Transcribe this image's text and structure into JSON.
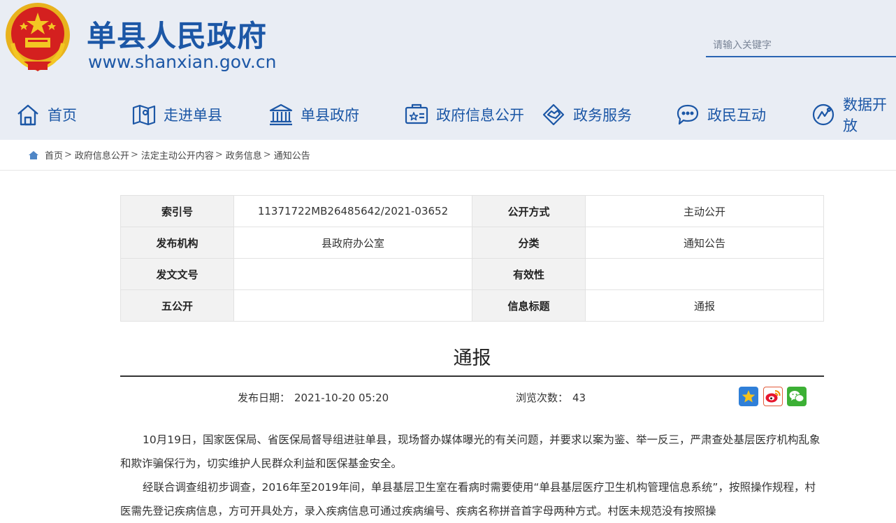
{
  "header": {
    "site_title": "单县人民政府",
    "site_url": "www.shanxian.gov.cn",
    "search_placeholder": "请输入关键字"
  },
  "nav": {
    "items": [
      {
        "label": "首页",
        "icon": "home-icon"
      },
      {
        "label": "走进单县",
        "icon": "map-icon"
      },
      {
        "label": "单县政府",
        "icon": "government-building-icon"
      },
      {
        "label": "政府信息公开",
        "icon": "info-board-icon"
      },
      {
        "label": "政务服务",
        "icon": "handshake-icon"
      },
      {
        "label": "政民互动",
        "icon": "chat-icon"
      },
      {
        "label": "数据开放",
        "icon": "data-open-icon"
      }
    ]
  },
  "breadcrumb": [
    "首页",
    "政府信息公开",
    "法定主动公开内容",
    "政务信息",
    "通知公告"
  ],
  "info_table": {
    "rows": [
      [
        {
          "label": "索引号",
          "value": "11371722MB26485642/2021-03652"
        },
        {
          "label": "公开方式",
          "value": "主动公开"
        }
      ],
      [
        {
          "label": "发布机构",
          "value": "县政府办公室"
        },
        {
          "label": "分类",
          "value": "通知公告"
        }
      ],
      [
        {
          "label": "发文文号",
          "value": ""
        },
        {
          "label": "有效性",
          "value": ""
        }
      ],
      [
        {
          "label": "五公开",
          "value": ""
        },
        {
          "label": "信息标题",
          "value": "通报"
        }
      ]
    ]
  },
  "article": {
    "title": "通报",
    "publish_label": "发布日期：",
    "publish_date": "2021-10-20 05:20",
    "views_label": "浏览次数：",
    "views": "43",
    "share_icons": [
      "share-star-icon",
      "weibo-icon",
      "wechat-icon"
    ],
    "paragraphs": [
      "10月19日，国家医保局、省医保局督导组进驻单县，现场督办媒体曝光的有关问题，并要求以案为鉴、举一反三，严肃查处基层医疗机构乱象和欺诈骗保行为，切实维护人民群众利益和医保基金安全。",
      "经联合调查组初步调查，2016年至2019年间，单县基层卫生室在看病时需要使用“单县基层医疗卫生机构管理信息系统”，按照操作规程，村医需先登记疾病信息，方可开具处方，录入疾病信息可通过疾病编号、疾病名称拼音首字母两种方式。村医未规范没有按照操"
    ]
  },
  "colors": {
    "brand_blue": "#1c57a6",
    "header_bg": "#e9edf4",
    "label_bg": "#f2f2f2"
  }
}
